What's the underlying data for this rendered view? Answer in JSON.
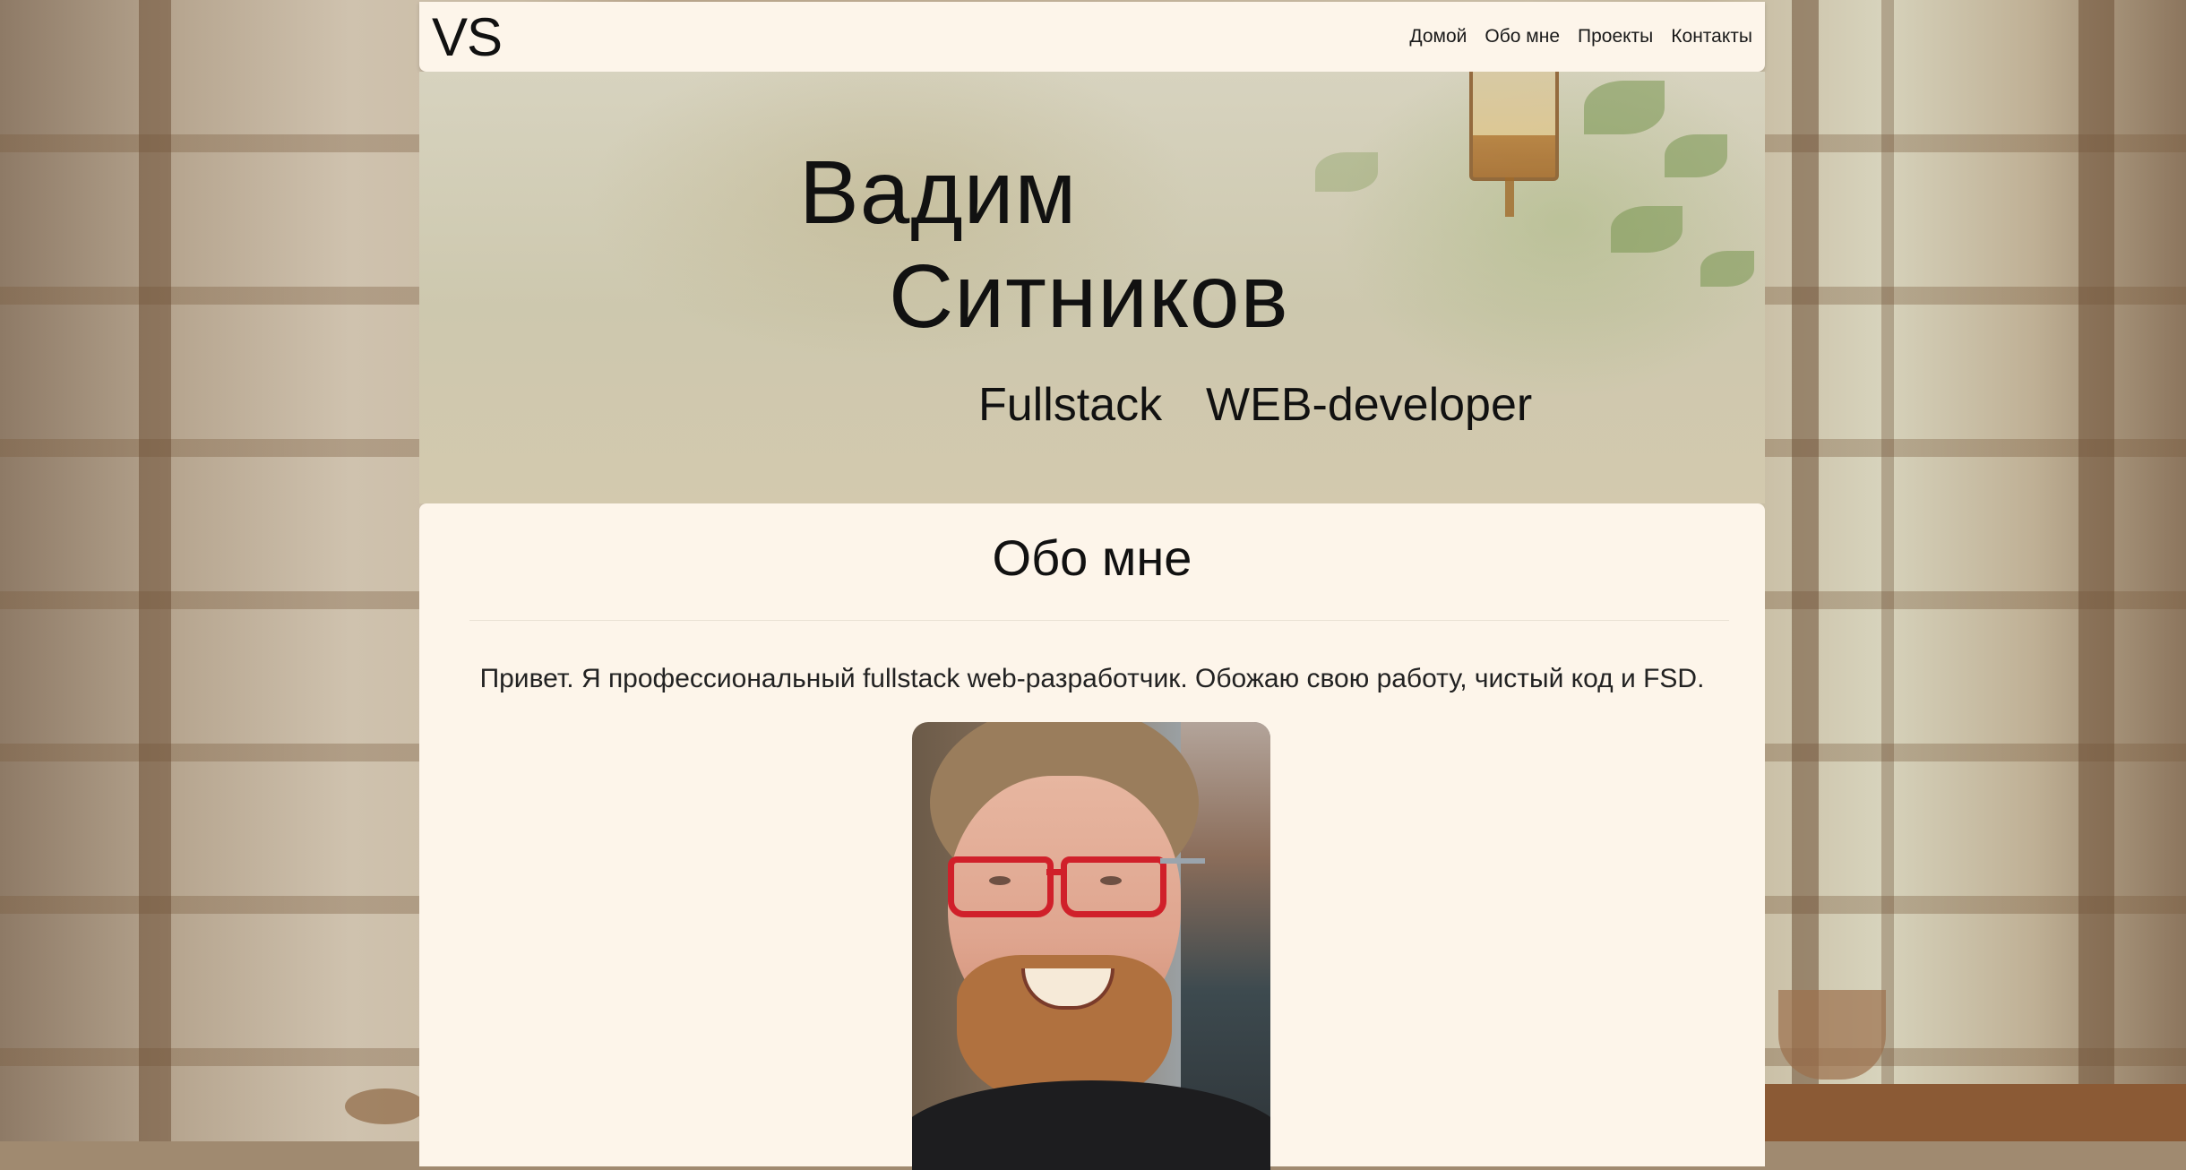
{
  "navbar": {
    "logo": "VS",
    "links": [
      "Домой",
      "Обо мне",
      "Проекты",
      "Контакты"
    ]
  },
  "hero": {
    "first_name": "Вадим",
    "last_name": "Ситников",
    "role": "Fullstack  WEB-developer"
  },
  "about": {
    "title": "Обо мне",
    "text": "Привет. Я профессиональный fullstack web-разработчик. Обожаю свою работу, чистый код и FSD."
  },
  "colors": {
    "panel_background": "#fdf5ea",
    "glasses_accent": "#d0202a"
  }
}
